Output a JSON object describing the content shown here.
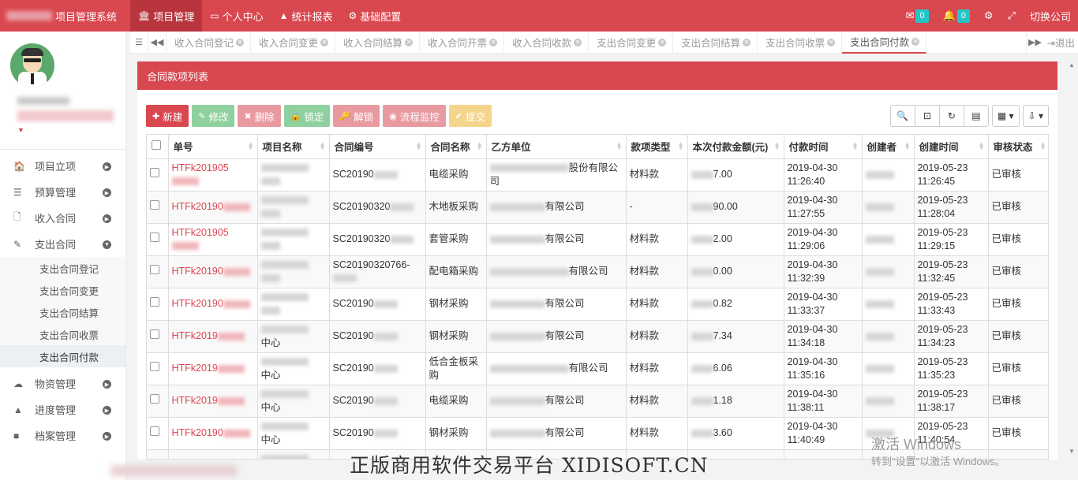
{
  "app": {
    "title": "项目管理系统"
  },
  "topnav": [
    {
      "icon": "bank-icon",
      "glyph": "🏛",
      "label": "项目管理",
      "active": true
    },
    {
      "icon": "id-card-icon",
      "glyph": "▭",
      "label": "个人中心"
    },
    {
      "icon": "area-chart-icon",
      "glyph": "▲",
      "label": "统计报表"
    },
    {
      "icon": "gear-icon",
      "glyph": "⚙",
      "label": "基础配置"
    }
  ],
  "topright": {
    "mail_count": "0",
    "bell_count": "0",
    "switch_label": "切换公司"
  },
  "sidebar": {
    "menu": [
      {
        "label": "项目立项",
        "glyph": "🏠",
        "icon": "home-icon"
      },
      {
        "label": "预算管理",
        "glyph": "☰",
        "icon": "list-icon"
      },
      {
        "label": "收入合同",
        "glyph": "🗋",
        "icon": "file-icon"
      },
      {
        "label": "支出合同",
        "glyph": "✎",
        "icon": "edit-icon",
        "expanded": true
      }
    ],
    "submenu": [
      "支出合同登记",
      "支出合同变更",
      "支出合同结算",
      "支出合同收票",
      "支出合同付款"
    ],
    "submenu_active": 4,
    "menu2": [
      {
        "label": "物资管理",
        "glyph": "☁",
        "icon": "cloud-icon"
      },
      {
        "label": "进度管理",
        "glyph": "▲",
        "icon": "road-icon"
      },
      {
        "label": "档案管理",
        "glyph": "■",
        "icon": "folder-icon"
      }
    ]
  },
  "tabs": [
    "收入合同登记",
    "收入合同变更",
    "收入合同结算",
    "收入合同开票",
    "收入合同收款",
    "支出合同变更",
    "支出合同结算",
    "支出合同收票",
    "支出合同付款"
  ],
  "tab_active": 8,
  "logout_label": "退出",
  "panel": {
    "title": "合同款项列表"
  },
  "toolbar": [
    {
      "label": "新建",
      "glyph": "✚",
      "cls": "b-new",
      "name": "new-button",
      "icon": "plus-icon"
    },
    {
      "label": "修改",
      "glyph": "✎",
      "cls": "b-edit",
      "name": "edit-button",
      "icon": "edit-icon"
    },
    {
      "label": "删除",
      "glyph": "✖",
      "cls": "b-del",
      "name": "delete-button",
      "icon": "times-icon"
    },
    {
      "label": "锁定",
      "glyph": "🔒",
      "cls": "b-lock",
      "name": "lock-button",
      "icon": "lock-icon"
    },
    {
      "label": "解锁",
      "glyph": "🔑",
      "cls": "b-unlock",
      "name": "unlock-button",
      "icon": "key-icon"
    },
    {
      "label": "流程监控",
      "glyph": "◉",
      "cls": "b-flow",
      "name": "flow-monitor-button",
      "icon": "eye-icon"
    },
    {
      "label": "提交",
      "glyph": "✔",
      "cls": "b-submit",
      "name": "submit-button",
      "icon": "check-icon"
    }
  ],
  "tools": [
    {
      "glyph": "🔍",
      "name": "search-tool-button",
      "icon": "search-icon"
    },
    {
      "glyph": "⊡",
      "name": "toggle-tool-button",
      "icon": "minus-square-icon"
    },
    {
      "glyph": "↻",
      "name": "refresh-tool-button",
      "icon": "refresh-icon"
    },
    {
      "glyph": "▤",
      "name": "toggle-view-button",
      "icon": "list-alt-icon"
    },
    {
      "glyph": "▦ ▾",
      "name": "columns-button",
      "icon": "th-icon"
    },
    {
      "glyph": "⇩ ▾",
      "name": "export-button",
      "icon": "download-icon"
    }
  ],
  "table": {
    "columns": [
      "单号",
      "项目名称",
      "合同编号",
      "合同名称",
      "乙方单位",
      "款项类型",
      "本次付款金额(元)",
      "付款时间",
      "创建者",
      "创建时间",
      "审核状态"
    ],
    "rows": [
      {
        "no": "HTFk201905",
        "project": "",
        "contract_no": "SC20190",
        "contract_name": "电缆采购",
        "party_b": "股份有限公司",
        "type": "材料款",
        "amount": "7.00",
        "pay_date": "2019-04-30",
        "pay_time": "11:26:40",
        "create_date": "2019-05-23",
        "create_time": "11:26:45",
        "status": "已审核"
      },
      {
        "no": "HTFk20190",
        "project": "",
        "contract_no": "SC20190320",
        "contract_name": "木地板采购",
        "party_b": "有限公司",
        "type": "-",
        "amount": "90.00",
        "pay_date": "2019-04-30",
        "pay_time": "11:27:55",
        "create_date": "2019-05-23",
        "create_time": "11:28:04",
        "status": "已审核"
      },
      {
        "no": "HTFk201905",
        "project": "",
        "contract_no": "SC20190320",
        "contract_name": "套管采购",
        "party_b": "有限公司",
        "type": "材料款",
        "amount": "2.00",
        "pay_date": "2019-04-30",
        "pay_time": "11:29:06",
        "create_date": "2019-05-23",
        "create_time": "11:29:15",
        "status": "已审核"
      },
      {
        "no": "HTFk20190",
        "project": "",
        "contract_no": "SC20190320766-",
        "contract_name": "配电箱采购",
        "party_b": "有限公司",
        "type": "材料款",
        "amount": "0.00",
        "pay_date": "2019-04-30",
        "pay_time": "11:32:39",
        "create_date": "2019-05-23",
        "create_time": "11:32:45",
        "status": "已审核"
      },
      {
        "no": "HTFk20190",
        "project": "",
        "contract_no": "SC20190",
        "contract_name": "钢材采购",
        "party_b": "有限公司",
        "type": "材料款",
        "amount": "0.82",
        "pay_date": "2019-04-30",
        "pay_time": "11:33:37",
        "create_date": "2019-05-23",
        "create_time": "11:33:43",
        "status": "已审核"
      },
      {
        "no": "HTFk2019",
        "project": "中心",
        "contract_no": "SC20190",
        "contract_name": "钢材采购",
        "party_b": "有限公司",
        "type": "材料款",
        "amount": "7.34",
        "pay_date": "2019-04-30",
        "pay_time": "11:34:18",
        "create_date": "2019-05-23",
        "create_time": "11:34:23",
        "status": "已审核"
      },
      {
        "no": "HTFk2019",
        "project": "中心",
        "contract_no": "SC20190",
        "contract_name": "低合金板采购",
        "party_b": "有限公司",
        "type": "材料款",
        "amount": "6.06",
        "pay_date": "2019-04-30",
        "pay_time": "11:35:16",
        "create_date": "2019-05-23",
        "create_time": "11:35:23",
        "status": "已审核"
      },
      {
        "no": "HTFk2019",
        "project": "中心",
        "contract_no": "SC20190",
        "contract_name": "电缆采购",
        "party_b": "有限公司",
        "type": "材料款",
        "amount": "1.18",
        "pay_date": "2019-04-30",
        "pay_time": "11:38:11",
        "create_date": "2019-05-23",
        "create_time": "11:38:17",
        "status": "已审核"
      },
      {
        "no": "HTFk20190",
        "project": "中心",
        "contract_no": "SC20190",
        "contract_name": "钢材采购",
        "party_b": "有限公司",
        "type": "材料款",
        "amount": "3.60",
        "pay_date": "2019-04-30",
        "pay_time": "11:40:49",
        "create_date": "2019-05-23",
        "create_time": "11:40:54",
        "status": "已审核"
      },
      {
        "no": "",
        "project": "",
        "contract_no": "SC20",
        "contract_name": "",
        "party_b": "",
        "type": "",
        "amount": "",
        "pay_date": "2019-04-30",
        "pay_time": "",
        "create_date": "2019-05-23",
        "create_time": "",
        "status": ""
      }
    ]
  },
  "watermark": "正版商用软件交易平台 XIDISOFT.CN",
  "windows": {
    "line1": "激活 Windows",
    "line2": "转到\"设置\"以激活 Windows。"
  },
  "colors": {
    "primary": "#d9474f",
    "badge": "#23c6c8"
  }
}
